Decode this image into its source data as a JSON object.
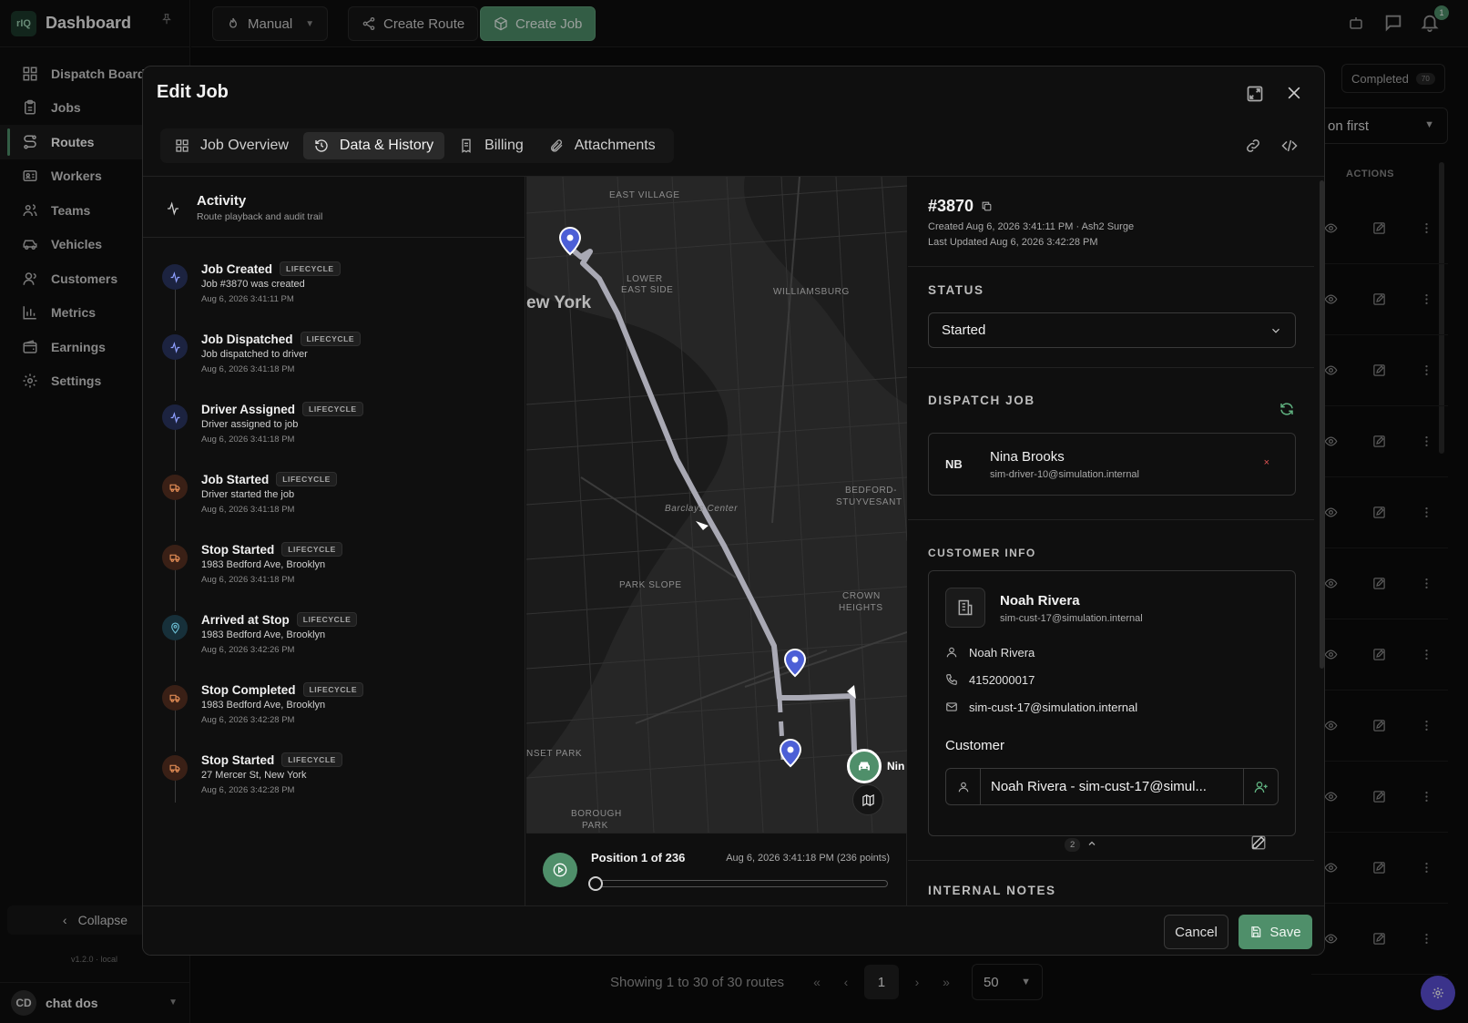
{
  "app": {
    "logo_text": "rIQ",
    "title": "Dashboard",
    "version": "v1.2.0 · local"
  },
  "sidebar": {
    "items": [
      {
        "label": "Dispatch Board",
        "icon": "grid-icon"
      },
      {
        "label": "Jobs",
        "icon": "clipboard-icon"
      },
      {
        "label": "Routes",
        "icon": "route-icon"
      },
      {
        "label": "Workers",
        "icon": "id-card-icon"
      },
      {
        "label": "Teams",
        "icon": "users-icon"
      },
      {
        "label": "Vehicles",
        "icon": "car-icon"
      },
      {
        "label": "Customers",
        "icon": "user-group-icon"
      },
      {
        "label": "Metrics",
        "icon": "bar-chart-icon"
      },
      {
        "label": "Earnings",
        "icon": "wallet-icon"
      },
      {
        "label": "Settings",
        "icon": "gear-icon"
      }
    ],
    "active": "Routes",
    "collapse_label": "Collapse",
    "user": {
      "initials": "CD",
      "name": "chat dos"
    }
  },
  "topbar": {
    "mode_label": "Manual",
    "create_route_label": "Create Route",
    "create_job_label": "Create Job",
    "notification_count": "1"
  },
  "background": {
    "completed_label": "Completed",
    "completed_count": "70",
    "sort_label": "on first",
    "actions_header": "ACTIONS",
    "pagination_text": "Showing 1 to 30 of 30 routes",
    "current_page": "1",
    "page_size": "50"
  },
  "modal": {
    "title": "Edit Job",
    "tabs": [
      {
        "label": "Job Overview",
        "icon": "grid-icon"
      },
      {
        "label": "Data & History",
        "icon": "history-icon"
      },
      {
        "label": "Billing",
        "icon": "receipt-icon"
      },
      {
        "label": "Attachments",
        "icon": "paperclip-icon"
      }
    ],
    "active_tab": "Data & History",
    "cancel_label": "Cancel",
    "save_label": "Save"
  },
  "activity": {
    "title": "Activity",
    "subtitle": "Route playback and audit trail",
    "events": [
      {
        "title": "Job Created",
        "badge": "LIFECYCLE",
        "desc": "Job #3870 was created",
        "time": "Aug 6, 2026 3:41:11 PM",
        "icon": "activity-icon",
        "kind": "blue"
      },
      {
        "title": "Job Dispatched",
        "badge": "LIFECYCLE",
        "desc": "Job dispatched to driver",
        "time": "Aug 6, 2026 3:41:18 PM",
        "icon": "activity-icon",
        "kind": "blue"
      },
      {
        "title": "Driver Assigned",
        "badge": "LIFECYCLE",
        "desc": "Driver assigned to job",
        "time": "Aug 6, 2026 3:41:18 PM",
        "icon": "activity-icon",
        "kind": "blue"
      },
      {
        "title": "Job Started",
        "badge": "LIFECYCLE",
        "desc": "Driver started the job",
        "time": "Aug 6, 2026 3:41:18 PM",
        "icon": "truck-icon",
        "kind": "orange"
      },
      {
        "title": "Stop Started",
        "badge": "LIFECYCLE",
        "desc": "1983 Bedford Ave, Brooklyn",
        "time": "Aug 6, 2026 3:41:18 PM",
        "icon": "truck-icon",
        "kind": "orange"
      },
      {
        "title": "Arrived at Stop",
        "badge": "LIFECYCLE",
        "desc": "1983 Bedford Ave, Brooklyn",
        "time": "Aug 6, 2026 3:42:26 PM",
        "icon": "map-pin-icon",
        "kind": "teal"
      },
      {
        "title": "Stop Completed",
        "badge": "LIFECYCLE",
        "desc": "1983 Bedford Ave, Brooklyn",
        "time": "Aug 6, 2026 3:42:28 PM",
        "icon": "truck-icon",
        "kind": "orange"
      },
      {
        "title": "Stop Started",
        "badge": "LIFECYCLE",
        "desc": "27 Mercer St, New York",
        "time": "Aug 6, 2026 3:42:28 PM",
        "icon": "truck-icon",
        "kind": "orange"
      }
    ]
  },
  "map": {
    "labels": {
      "east_village": "EAST VILLAGE",
      "lower_east_side_1": "LOWER",
      "lower_east_side_2": "EAST SIDE",
      "new_york": "ew York",
      "williamsburg": "WILLIAMSBURG",
      "bedford_1": "BEDFORD-",
      "bedford_2": "STUYVESANT",
      "barclays": "Barclays Center",
      "park_slope": "PARK SLOPE",
      "crown_1": "CROWN",
      "crown_2": "HEIGHTS",
      "sunset_park": "NSET PARK",
      "borough_1": "BOROUGH",
      "borough_2": "PARK"
    },
    "vehicle_label": "Nin",
    "colors": {
      "route": "#a9a9b4",
      "pin": "#4c5fd6",
      "vehicle": "#4f8f6a"
    }
  },
  "playback": {
    "position_text": "Position 1 of 236",
    "time_text": "Aug 6, 2026 3:41:18 PM (236 points)",
    "position": 1,
    "total": 236
  },
  "details": {
    "job_number": "#3870",
    "created": "Created Aug 6, 2026 3:41:11 PM · Ash2 Surge",
    "updated": "Last Updated Aug 6, 2026 3:42:28 PM",
    "status_label": "STATUS",
    "status_value": "Started",
    "dispatch_label": "DISPATCH JOB",
    "driver": {
      "initials": "NB",
      "name": "Nina Brooks",
      "email": "sim-driver-10@simulation.internal",
      "remove": "×"
    },
    "customer_info_label": "CUSTOMER INFO",
    "customer": {
      "name": "Noah Rivera",
      "email_sub": "sim-cust-17@simulation.internal",
      "contact_name": "Noah Rivera",
      "phone": "4152000017",
      "email": "sim-cust-17@simulation.internal",
      "select_label": "Customer",
      "select_value": "Noah Rivera - sim-cust-17@simul..."
    },
    "notes_label": "INTERNAL NOTES",
    "notes_count": "2"
  }
}
